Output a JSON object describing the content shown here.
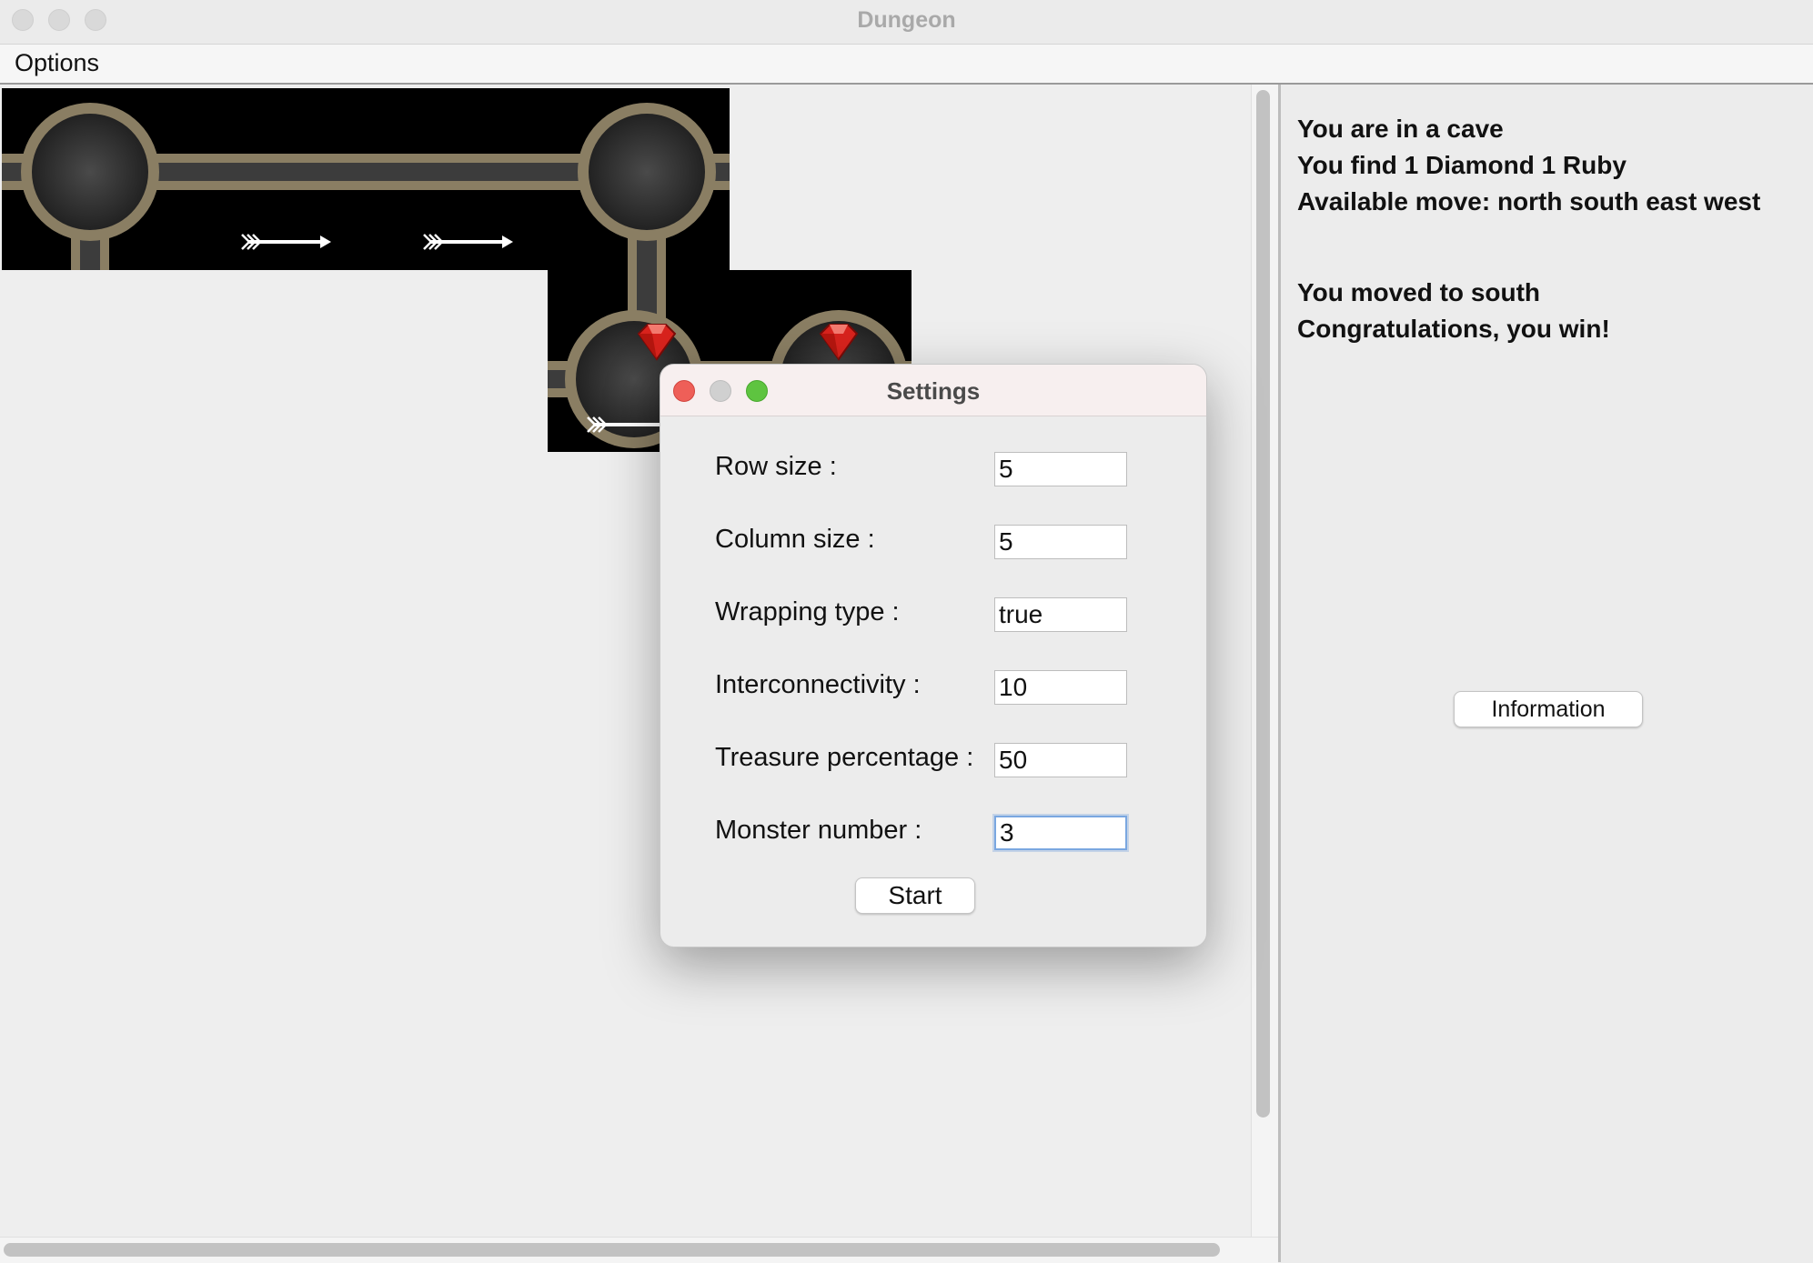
{
  "window": {
    "title": "Dungeon"
  },
  "menu": {
    "options_label": "Options"
  },
  "info": {
    "lines": [
      "You are in a cave",
      "You find 1 Diamond 1 Ruby",
      "Available move: north south east west",
      "",
      "You moved to south",
      "Congratulations, you win!"
    ],
    "button_label": "Information"
  },
  "settings": {
    "title": "Settings",
    "fields": [
      {
        "label": "Row size :",
        "value": "5"
      },
      {
        "label": "Column size :",
        "value": "5"
      },
      {
        "label": "Wrapping type :",
        "value": "true"
      },
      {
        "label": "Interconnectivity :",
        "value": "10"
      },
      {
        "label": "Treasure percentage :",
        "value": "50"
      },
      {
        "label": "Monster number :",
        "value": "3"
      }
    ],
    "start_label": "Start"
  },
  "map": {
    "tiles": [
      {
        "name": "tile-cave-r0c0",
        "items": [
          "arrow"
        ]
      },
      {
        "name": "tile-cave-r0c1",
        "items": [
          "arrow"
        ]
      },
      {
        "name": "tile-cave-r0c2",
        "items": []
      },
      {
        "name": "tile-cave-r1c3",
        "items": [
          "ruby"
        ]
      },
      {
        "name": "tile-cave-r1c4",
        "items": [
          "ruby"
        ]
      }
    ]
  },
  "colors": {
    "close": "#ee5f58",
    "minimize": "#d0d0d0",
    "maximize": "#5ec440",
    "ruby": "#d8231d",
    "focus_ring": "#7aa7e0"
  }
}
